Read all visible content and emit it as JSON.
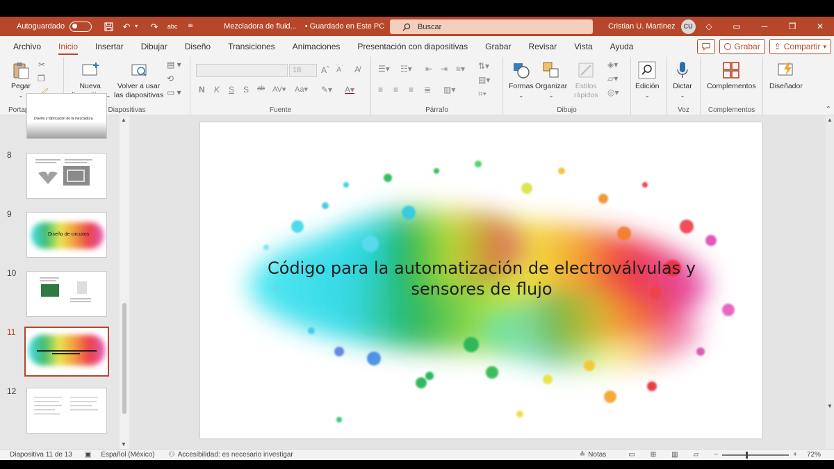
{
  "titlebar": {
    "autosave_label": "Autoguardado",
    "doc_name": "Mezcladora de fluid...",
    "save_status": "• Guardado en Este PC",
    "search_placeholder": "Buscar",
    "user_name": "Cristian U. Martinez",
    "user_initials": "CU",
    "accent": "#b7472a"
  },
  "tabs": [
    "Archivo",
    "Inicio",
    "Insertar",
    "Dibujar",
    "Diseño",
    "Transiciones",
    "Animaciones",
    "Presentación con diapositivas",
    "Grabar",
    "Revisar",
    "Vista",
    "Ayuda"
  ],
  "active_tab": "Inicio",
  "actions": {
    "record_label": "Grabar",
    "share_label": "Compartir"
  },
  "ribbon": {
    "portapapeles": {
      "label": "Portapapeles",
      "paste": "Pegar"
    },
    "diapositivas": {
      "label": "Diapositivas",
      "new_slide_1": "Nueva",
      "new_slide_2": "diapositiva",
      "reuse_1": "Volver a usar",
      "reuse_2": "las diapositivas"
    },
    "fuente": {
      "label": "Fuente",
      "size": "18"
    },
    "parrafo": {
      "label": "Párrafo"
    },
    "dibujo": {
      "label": "Dibujo",
      "shapes": "Formas",
      "arrange": "Organizar",
      "styles_1": "Estilos",
      "styles_2": "rápidos"
    },
    "edicion": {
      "label": "Edición"
    },
    "voz": {
      "label": "Voz",
      "dictate": "Dictar"
    },
    "complementos": {
      "label": "Complementos",
      "button": "Complementos"
    },
    "disenador": {
      "label": "Diseñador"
    }
  },
  "thumbnails": [
    {
      "num": "8"
    },
    {
      "num": "9",
      "caption": "Diseño de circuitos"
    },
    {
      "num": "10"
    },
    {
      "num": "11"
    },
    {
      "num": "12"
    }
  ],
  "thumb7_caption": "Diseño y fabricación de la mezcladora",
  "slide": {
    "title_line1": "Código para la automatización de electroválvulas y",
    "title_line2": "sensores de flujo"
  },
  "statusbar": {
    "slide_count": "Diapositiva 11 de 13",
    "language": "Español (México)",
    "accessibility": "Accesibilidad: es necesario investigar",
    "notes": "Notas",
    "zoom": "72%"
  }
}
